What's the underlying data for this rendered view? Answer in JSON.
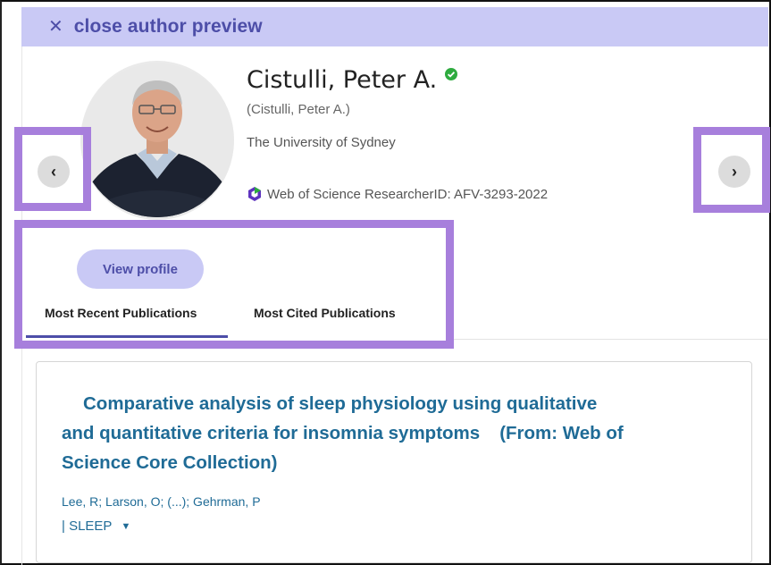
{
  "header": {
    "close_icon": "✕",
    "close_label": "close author preview"
  },
  "author": {
    "name": "Cistulli, Peter A.",
    "alt_name": "(Cistulli, Peter A.)",
    "affiliation": "The University of Sydney",
    "researcher_id": "Web of Science ResearcherID: AFV-3293-2022",
    "verified": true
  },
  "navigation": {
    "prev_symbol": "‹",
    "next_symbol": "›"
  },
  "actions": {
    "view_profile": "View profile"
  },
  "tabs": [
    {
      "label": "Most Recent Publications",
      "active": true
    },
    {
      "label": "Most Cited Publications",
      "active": false
    }
  ],
  "publication": {
    "title": "Comparative analysis of sleep physiology using qualitative and quantitative criteria for insomnia symptoms",
    "source": "(From: Web of Science Core Collection)",
    "authors": "Lee, R; Larson, O; (...); Gehrman, P",
    "journal": "| SLEEP",
    "journal_caret": "▼"
  },
  "colors": {
    "accent": "#4d4ea8",
    "accent_bg": "#c9c9f5",
    "highlight": "#a77fdc",
    "link": "#1f6b96",
    "verified": "#2eab3f"
  },
  "icons": {
    "verified": "check-circle-icon",
    "wos_logo": "web-of-science-logo-icon"
  }
}
